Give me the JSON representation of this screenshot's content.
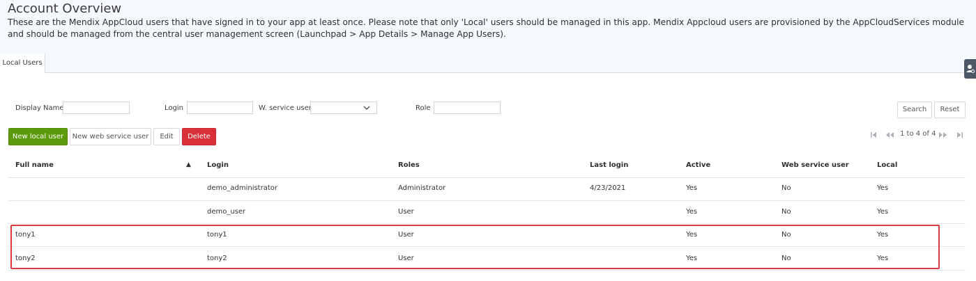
{
  "page": {
    "title": "Account Overview",
    "description": "These are the Mendix AppCloud users that have signed in to your app at least once. Please note that only 'Local' users should be managed in this app. Mendix Appcloud users are provisioned by the AppCloudServices module and should be managed from the central user management screen (Launchpad > App Details > Manage App Users)."
  },
  "tabs": [
    {
      "label": "Local Users",
      "active": true
    }
  ],
  "filters": {
    "display_name_label": "Display Name",
    "display_name_value": "",
    "login_label": "Login",
    "login_value": "",
    "service_user_label": "W. service user",
    "service_user_value": "",
    "role_label": "Role",
    "role_value": "",
    "search_label": "Search",
    "reset_label": "Reset"
  },
  "toolbar": {
    "new_local_user": "New local user",
    "new_web_service_user": "New web service user",
    "edit": "Edit",
    "delete": "Delete"
  },
  "pagination": {
    "text": "1 to 4 of 4"
  },
  "table": {
    "columns": [
      "Full name",
      "Login",
      "Roles",
      "Last login",
      "Active",
      "Web service user",
      "Local"
    ],
    "sort_indicator": "▲",
    "rows": [
      {
        "full_name": "",
        "login": "demo_administrator",
        "roles": "Administrator",
        "last_login": "4/23/2021",
        "active": "Yes",
        "web_service_user": "No",
        "local": "Yes"
      },
      {
        "full_name": "",
        "login": "demo_user",
        "roles": "User",
        "last_login": "",
        "active": "Yes",
        "web_service_user": "No",
        "local": "Yes"
      },
      {
        "full_name": "tony1",
        "login": "tony1",
        "roles": "User",
        "last_login": "",
        "active": "Yes",
        "web_service_user": "No",
        "local": "Yes"
      },
      {
        "full_name": "tony2",
        "login": "tony2",
        "roles": "User",
        "last_login": "",
        "active": "Yes",
        "web_service_user": "No",
        "local": "Yes"
      }
    ]
  },
  "colors": {
    "primary_green": "#5c9a0d",
    "danger_red": "#d9303a",
    "highlight_red": "#d93a3f",
    "header_bg": "#f5f8fc"
  },
  "icons": [
    "user-settings-icon",
    "chevron-down-icon",
    "first-page-icon",
    "previous-page-icon",
    "next-page-icon",
    "last-page-icon",
    "sort-ascending-icon"
  ]
}
